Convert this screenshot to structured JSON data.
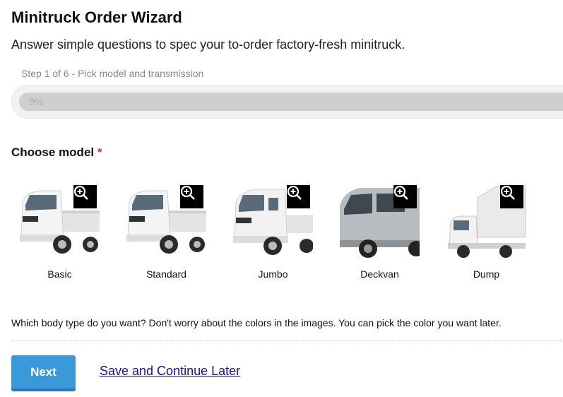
{
  "header": {
    "title": "Minitruck Order Wizard",
    "subtitle": "Answer simple questions to spec your to-order factory-fresh minitruck."
  },
  "progress": {
    "step_text": "Step 1 of 6 - Pick model and transmission",
    "percent_label": "0%",
    "percent": 0
  },
  "question": {
    "label": "Choose model",
    "required_mark": "*",
    "help": "Which body type do you want? Don't worry about the colors in the images. You can pick the color you want later."
  },
  "models": [
    {
      "label": "Basic",
      "icon": "zoom-in-icon"
    },
    {
      "label": "Standard",
      "icon": "zoom-in-icon"
    },
    {
      "label": "Jumbo",
      "icon": "zoom-in-icon"
    },
    {
      "label": "Deckvan",
      "icon": "zoom-in-icon"
    },
    {
      "label": "Dump",
      "icon": "zoom-in-icon"
    }
  ],
  "actions": {
    "next_label": "Next",
    "save_label": "Save and Continue Later"
  },
  "colors": {
    "accent": "#3a9ad9",
    "link": "#1a0dab",
    "required": "#c0392b"
  }
}
